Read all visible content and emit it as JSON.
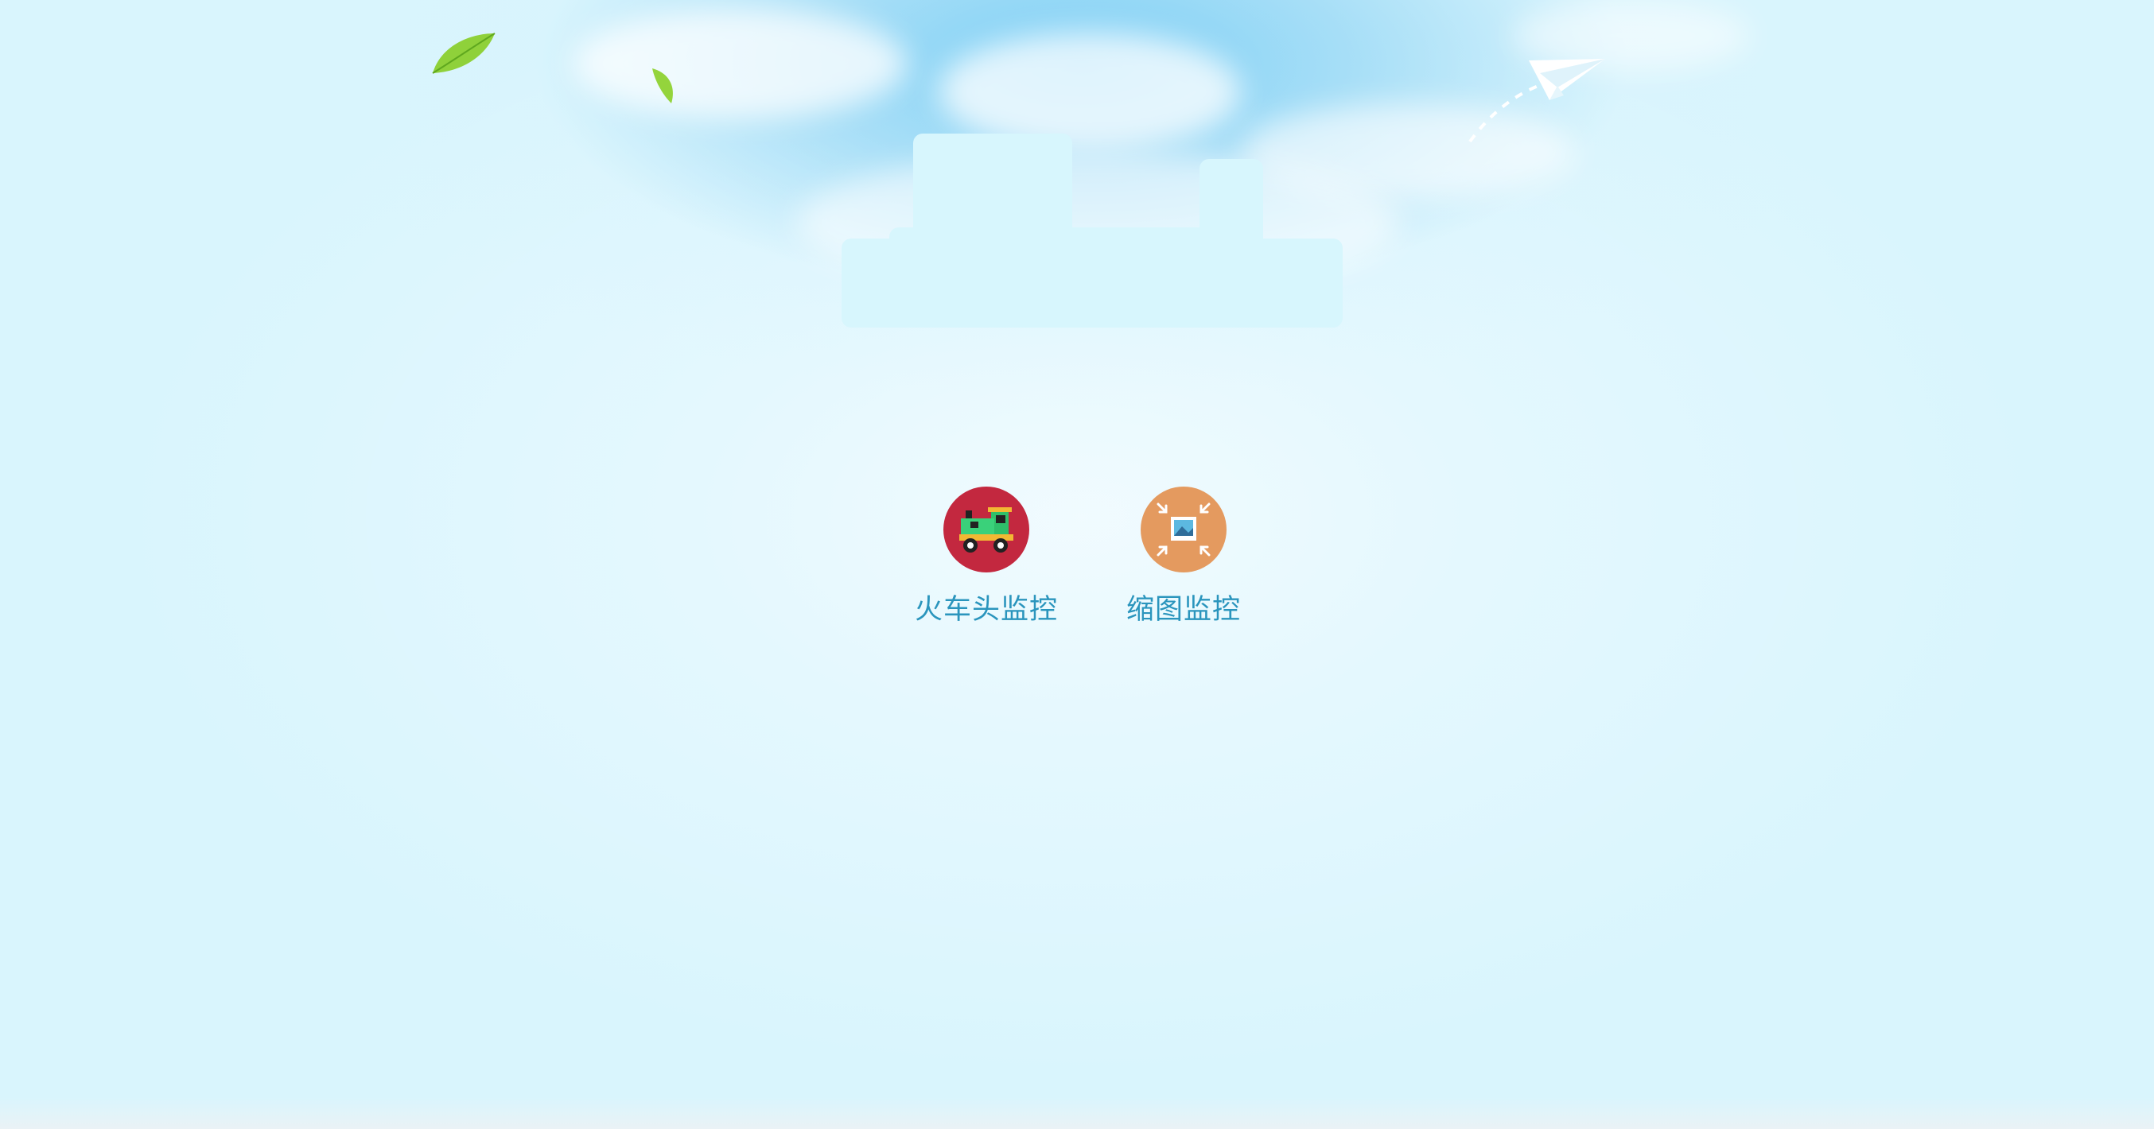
{
  "nav": {
    "items": [
      {
        "label": "火车头监控",
        "icon": "train-icon",
        "color": "#c3283f"
      },
      {
        "label": "缩图监控",
        "icon": "image-shrink-icon",
        "color": "#e49a5f"
      }
    ]
  },
  "theme": {
    "background": "#d9f5fd",
    "label_color": "#2a95bd"
  }
}
